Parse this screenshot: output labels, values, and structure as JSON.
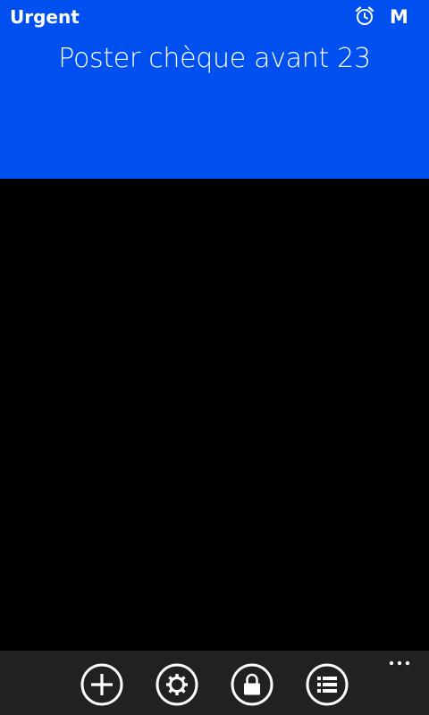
{
  "header": {
    "category": "Urgent",
    "priority": "M",
    "title": "Poster chèque avant 23",
    "alarm_icon": "alarm-clock-icon",
    "background_color": "#0050EF"
  },
  "app_bar": {
    "buttons": [
      {
        "icon": "add-icon"
      },
      {
        "icon": "settings-icon"
      },
      {
        "icon": "lock-icon"
      },
      {
        "icon": "list-icon"
      }
    ],
    "more_icon": "ellipsis-icon"
  }
}
